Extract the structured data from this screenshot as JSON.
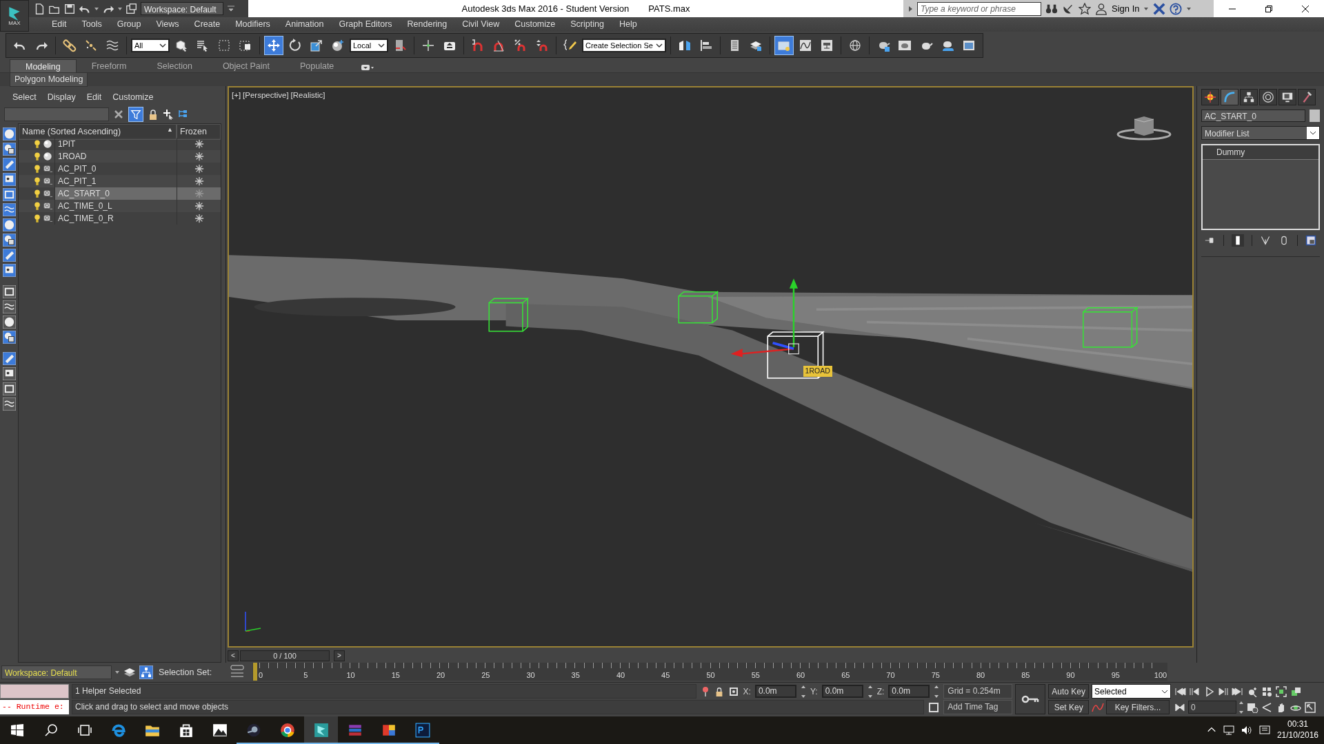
{
  "title_bar": {
    "logo_text": "MAX",
    "workspace": "Workspace: Default",
    "app_title": "Autodesk 3ds Max 2016 - Student Version",
    "file_name": "PATS.max",
    "search_placeholder": "Type a keyword or phrase",
    "sign_in": "Sign In"
  },
  "menu": [
    "Edit",
    "Tools",
    "Group",
    "Views",
    "Create",
    "Modifiers",
    "Animation",
    "Graph Editors",
    "Rendering",
    "Civil View",
    "Customize",
    "Scripting",
    "Help"
  ],
  "main_toolbar": [
    {
      "kind": "button",
      "selected": false
    },
    {
      "kind": "button",
      "selected": false
    },
    {
      "kind": "sep"
    },
    {
      "kind": "button",
      "selected": false
    },
    {
      "kind": "button",
      "selected": false
    },
    {
      "kind": "button",
      "selected": false
    },
    {
      "kind": "sep"
    },
    {
      "kind": "combo",
      "value": "All"
    },
    {
      "kind": "button",
      "selected": false
    },
    {
      "kind": "button",
      "selected": false
    },
    {
      "kind": "button",
      "selected": false
    },
    {
      "kind": "button",
      "selected": false
    },
    {
      "kind": "sep"
    },
    {
      "kind": "button",
      "selected": true
    },
    {
      "kind": "button",
      "selected": false
    },
    {
      "kind": "button",
      "selected": false
    },
    {
      "kind": "button",
      "selected": false
    },
    {
      "kind": "combo",
      "value": "Local"
    },
    {
      "kind": "button",
      "selected": false
    },
    {
      "kind": "sep"
    },
    {
      "kind": "button",
      "selected": false
    },
    {
      "kind": "button",
      "selected": false
    },
    {
      "kind": "sep"
    },
    {
      "kind": "button",
      "selected": false
    },
    {
      "kind": "button",
      "selected": false
    },
    {
      "kind": "button",
      "selected": false
    },
    {
      "kind": "button",
      "selected": false
    },
    {
      "kind": "sep"
    },
    {
      "kind": "button",
      "selected": false
    },
    {
      "kind": "combo",
      "value": "Create Selection Se"
    },
    {
      "kind": "sep"
    },
    {
      "kind": "button",
      "selected": false
    },
    {
      "kind": "button",
      "selected": false
    },
    {
      "kind": "sep"
    },
    {
      "kind": "button",
      "selected": false
    },
    {
      "kind": "button",
      "selected": false
    },
    {
      "kind": "sep"
    },
    {
      "kind": "button",
      "selected": true
    },
    {
      "kind": "button",
      "selected": false
    },
    {
      "kind": "button",
      "selected": false
    },
    {
      "kind": "sep"
    },
    {
      "kind": "button",
      "selected": false
    },
    {
      "kind": "sep"
    },
    {
      "kind": "button",
      "selected": false
    },
    {
      "kind": "button",
      "selected": false
    },
    {
      "kind": "button",
      "selected": false
    },
    {
      "kind": "button",
      "selected": false
    },
    {
      "kind": "button",
      "selected": false
    }
  ],
  "ribbon": {
    "tabs": [
      {
        "label": "Modeling",
        "selected": true
      },
      {
        "label": "Freeform",
        "selected": false
      },
      {
        "label": "Selection",
        "selected": false
      },
      {
        "label": "Object Paint",
        "selected": false
      },
      {
        "label": "Populate",
        "selected": false
      }
    ],
    "panel": "Polygon Modeling"
  },
  "scene_explorer": {
    "menu": [
      "Select",
      "Display",
      "Edit",
      "Customize"
    ],
    "filter_on": true,
    "columns": [
      "Name (Sorted Ascending)",
      "Frozen"
    ],
    "sort_mark": "▲",
    "rows": [
      {
        "name": "1PIT",
        "kind": "point",
        "selected": false
      },
      {
        "name": "1ROAD",
        "kind": "point",
        "selected": false
      },
      {
        "name": "AC_PIT_0",
        "kind": "dummy",
        "selected": false
      },
      {
        "name": "AC_PIT_1",
        "kind": "dummy",
        "selected": false
      },
      {
        "name": "AC_START_0",
        "kind": "dummy",
        "selected": true
      },
      {
        "name": "AC_TIME_0_L",
        "kind": "dummy",
        "selected": false
      },
      {
        "name": "AC_TIME_0_R",
        "kind": "dummy",
        "selected": false
      }
    ]
  },
  "viewport": {
    "labels": [
      "[+]",
      "[Perspective]",
      "[Realistic]"
    ],
    "objects": [
      {
        "selected": false
      },
      {
        "selected": false
      },
      {
        "selected": true
      },
      {
        "selected": false
      }
    ],
    "object_label": "1ROAD"
  },
  "command_panel": {
    "tabs": [
      {
        "selected": false
      },
      {
        "selected": true
      },
      {
        "selected": false
      },
      {
        "selected": false
      },
      {
        "selected": false
      },
      {
        "selected": false
      }
    ],
    "object_name": "AC_START_0",
    "modifier_list": "Modifier List",
    "stack": [
      {
        "label": "Dummy",
        "selected": false
      }
    ]
  },
  "time_slider": {
    "prev": "<",
    "position": "0 / 100",
    "next": ">",
    "ticks": [
      "0",
      "5",
      "10",
      "15",
      "20",
      "25",
      "30",
      "35",
      "40",
      "45",
      "50",
      "55",
      "60",
      "65",
      "70",
      "75",
      "80",
      "85",
      "90",
      "95",
      "100"
    ]
  },
  "workspace_bar": {
    "workspace": "Workspace: Default",
    "selection_set": "Selection Set:"
  },
  "status": {
    "listener_error": "-- Runtime e:",
    "selection": "1 Helper Selected",
    "prompt": "Click and drag to select and move objects",
    "x_label": "X:",
    "x": "0.0m",
    "y_label": "Y:",
    "y": "0.0m",
    "z_label": "Z:",
    "z": "0.0m",
    "grid": "Grid = 0.254m",
    "time_tag": "Add Time Tag",
    "auto_key": "Auto Key",
    "set_key": "Set Key",
    "key_set": "Selected",
    "key_filters": "Key Filters...",
    "frame": "0"
  },
  "taskbar": {
    "apps": [
      {
        "running": false,
        "selected": false
      },
      {
        "running": false,
        "selected": false
      },
      {
        "running": false,
        "selected": false
      },
      {
        "running": false,
        "selected": false
      },
      {
        "running": true,
        "selected": false
      },
      {
        "running": true,
        "selected": false
      },
      {
        "running": true,
        "selected": true
      },
      {
        "running": true,
        "selected": false
      },
      {
        "running": true,
        "selected": false
      },
      {
        "running": true,
        "selected": false
      }
    ],
    "time": "00:31",
    "date": "21/10/2016"
  }
}
